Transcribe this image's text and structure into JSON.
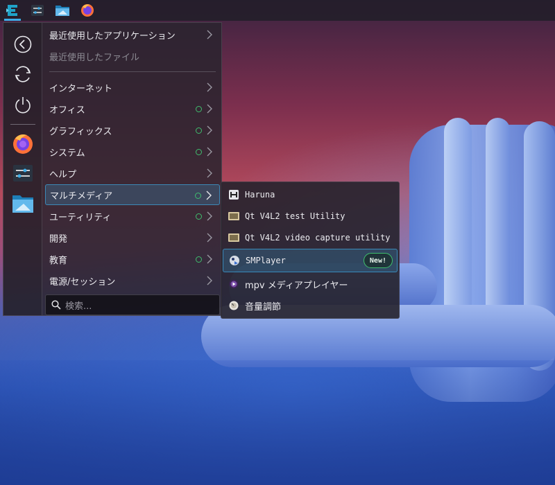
{
  "panel": {
    "buttons": [
      {
        "name": "application-launcher-icon"
      },
      {
        "name": "settings-icon"
      },
      {
        "name": "file-manager-icon"
      },
      {
        "name": "firefox-icon"
      }
    ]
  },
  "menu": {
    "favorites": [
      {
        "name": "back-icon"
      },
      {
        "name": "restart-icon"
      },
      {
        "name": "power-icon"
      },
      {
        "name": "firefox-icon"
      },
      {
        "name": "settings-icon"
      },
      {
        "name": "file-manager-icon"
      }
    ],
    "recent_apps": "最近使用したアプリケーション",
    "recent_files": "最近使用したファイル",
    "categories": [
      {
        "label": "インターネット",
        "dot": false
      },
      {
        "label": "オフィス",
        "dot": true
      },
      {
        "label": "グラフィックス",
        "dot": true
      },
      {
        "label": "システム",
        "dot": true
      },
      {
        "label": "ヘルプ",
        "dot": false
      },
      {
        "label": "マルチメディア",
        "dot": true
      },
      {
        "label": "ユーティリティ",
        "dot": true
      },
      {
        "label": "開発",
        "dot": false
      },
      {
        "label": "教育",
        "dot": true
      },
      {
        "label": "電源/セッション",
        "dot": false
      }
    ],
    "search_placeholder": "検索..."
  },
  "submenu": {
    "apps": [
      {
        "label": "Haruna",
        "icon": "haruna-icon"
      },
      {
        "label": "Qt V4L2 test Utility",
        "icon": "qv4l2-icon"
      },
      {
        "label": "Qt V4L2 video capture utility",
        "icon": "qvidcap-icon"
      },
      {
        "label": "SMPlayer",
        "icon": "smplayer-icon",
        "badge": "New!"
      },
      {
        "label": "mpv メディアプレイヤー",
        "icon": "mpv-icon"
      },
      {
        "label": "音量調節",
        "icon": "volume-control-icon"
      }
    ]
  },
  "colors": {
    "accent": "#3daee9",
    "new_indicator": "#3fbf6e"
  }
}
